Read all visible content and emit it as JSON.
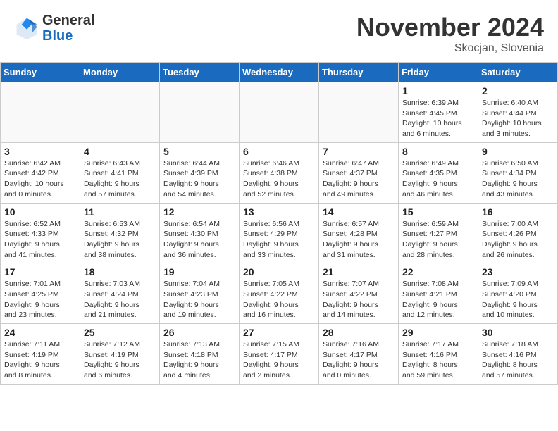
{
  "logo": {
    "general": "General",
    "blue": "Blue"
  },
  "header": {
    "month": "November 2024",
    "location": "Skocjan, Slovenia"
  },
  "weekdays": [
    "Sunday",
    "Monday",
    "Tuesday",
    "Wednesday",
    "Thursday",
    "Friday",
    "Saturday"
  ],
  "weeks": [
    [
      {
        "day": "",
        "info": ""
      },
      {
        "day": "",
        "info": ""
      },
      {
        "day": "",
        "info": ""
      },
      {
        "day": "",
        "info": ""
      },
      {
        "day": "",
        "info": ""
      },
      {
        "day": "1",
        "info": "Sunrise: 6:39 AM\nSunset: 4:45 PM\nDaylight: 10 hours\nand 6 minutes."
      },
      {
        "day": "2",
        "info": "Sunrise: 6:40 AM\nSunset: 4:44 PM\nDaylight: 10 hours\nand 3 minutes."
      }
    ],
    [
      {
        "day": "3",
        "info": "Sunrise: 6:42 AM\nSunset: 4:42 PM\nDaylight: 10 hours\nand 0 minutes."
      },
      {
        "day": "4",
        "info": "Sunrise: 6:43 AM\nSunset: 4:41 PM\nDaylight: 9 hours\nand 57 minutes."
      },
      {
        "day": "5",
        "info": "Sunrise: 6:44 AM\nSunset: 4:39 PM\nDaylight: 9 hours\nand 54 minutes."
      },
      {
        "day": "6",
        "info": "Sunrise: 6:46 AM\nSunset: 4:38 PM\nDaylight: 9 hours\nand 52 minutes."
      },
      {
        "day": "7",
        "info": "Sunrise: 6:47 AM\nSunset: 4:37 PM\nDaylight: 9 hours\nand 49 minutes."
      },
      {
        "day": "8",
        "info": "Sunrise: 6:49 AM\nSunset: 4:35 PM\nDaylight: 9 hours\nand 46 minutes."
      },
      {
        "day": "9",
        "info": "Sunrise: 6:50 AM\nSunset: 4:34 PM\nDaylight: 9 hours\nand 43 minutes."
      }
    ],
    [
      {
        "day": "10",
        "info": "Sunrise: 6:52 AM\nSunset: 4:33 PM\nDaylight: 9 hours\nand 41 minutes."
      },
      {
        "day": "11",
        "info": "Sunrise: 6:53 AM\nSunset: 4:32 PM\nDaylight: 9 hours\nand 38 minutes."
      },
      {
        "day": "12",
        "info": "Sunrise: 6:54 AM\nSunset: 4:30 PM\nDaylight: 9 hours\nand 36 minutes."
      },
      {
        "day": "13",
        "info": "Sunrise: 6:56 AM\nSunset: 4:29 PM\nDaylight: 9 hours\nand 33 minutes."
      },
      {
        "day": "14",
        "info": "Sunrise: 6:57 AM\nSunset: 4:28 PM\nDaylight: 9 hours\nand 31 minutes."
      },
      {
        "day": "15",
        "info": "Sunrise: 6:59 AM\nSunset: 4:27 PM\nDaylight: 9 hours\nand 28 minutes."
      },
      {
        "day": "16",
        "info": "Sunrise: 7:00 AM\nSunset: 4:26 PM\nDaylight: 9 hours\nand 26 minutes."
      }
    ],
    [
      {
        "day": "17",
        "info": "Sunrise: 7:01 AM\nSunset: 4:25 PM\nDaylight: 9 hours\nand 23 minutes."
      },
      {
        "day": "18",
        "info": "Sunrise: 7:03 AM\nSunset: 4:24 PM\nDaylight: 9 hours\nand 21 minutes."
      },
      {
        "day": "19",
        "info": "Sunrise: 7:04 AM\nSunset: 4:23 PM\nDaylight: 9 hours\nand 19 minutes."
      },
      {
        "day": "20",
        "info": "Sunrise: 7:05 AM\nSunset: 4:22 PM\nDaylight: 9 hours\nand 16 minutes."
      },
      {
        "day": "21",
        "info": "Sunrise: 7:07 AM\nSunset: 4:22 PM\nDaylight: 9 hours\nand 14 minutes."
      },
      {
        "day": "22",
        "info": "Sunrise: 7:08 AM\nSunset: 4:21 PM\nDaylight: 9 hours\nand 12 minutes."
      },
      {
        "day": "23",
        "info": "Sunrise: 7:09 AM\nSunset: 4:20 PM\nDaylight: 9 hours\nand 10 minutes."
      }
    ],
    [
      {
        "day": "24",
        "info": "Sunrise: 7:11 AM\nSunset: 4:19 PM\nDaylight: 9 hours\nand 8 minutes."
      },
      {
        "day": "25",
        "info": "Sunrise: 7:12 AM\nSunset: 4:19 PM\nDaylight: 9 hours\nand 6 minutes."
      },
      {
        "day": "26",
        "info": "Sunrise: 7:13 AM\nSunset: 4:18 PM\nDaylight: 9 hours\nand 4 minutes."
      },
      {
        "day": "27",
        "info": "Sunrise: 7:15 AM\nSunset: 4:17 PM\nDaylight: 9 hours\nand 2 minutes."
      },
      {
        "day": "28",
        "info": "Sunrise: 7:16 AM\nSunset: 4:17 PM\nDaylight: 9 hours\nand 0 minutes."
      },
      {
        "day": "29",
        "info": "Sunrise: 7:17 AM\nSunset: 4:16 PM\nDaylight: 8 hours\nand 59 minutes."
      },
      {
        "day": "30",
        "info": "Sunrise: 7:18 AM\nSunset: 4:16 PM\nDaylight: 8 hours\nand 57 minutes."
      }
    ]
  ]
}
